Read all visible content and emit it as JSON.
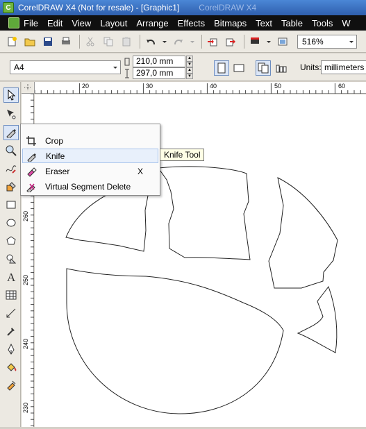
{
  "window": {
    "title": "CorelDRAW X4 (Not for resale) - [Graphic1]",
    "faded_title": "CorelDRAW X4"
  },
  "menu": [
    "File",
    "Edit",
    "View",
    "Layout",
    "Arrange",
    "Effects",
    "Bitmaps",
    "Text",
    "Table",
    "Tools",
    "W"
  ],
  "zoom": "516%",
  "property_bar": {
    "paper": "A4",
    "width": "210,0 mm",
    "height": "297,0 mm",
    "units_label": "Units:",
    "units_value": "millimeters"
  },
  "ruler": {
    "top_labels": [
      "20",
      "30",
      "40",
      "50",
      "60"
    ],
    "left_labels": [
      "260",
      "250",
      "240",
      "230"
    ]
  },
  "flyout": [
    {
      "label": "Crop",
      "shortcut": "",
      "icon": "crop-icon"
    },
    {
      "label": "Knife",
      "shortcut": "",
      "icon": "knife-icon"
    },
    {
      "label": "Eraser",
      "shortcut": "X",
      "icon": "eraser-icon"
    },
    {
      "label": "Virtual Segment Delete",
      "shortcut": "",
      "icon": "virtual-segment-delete-icon"
    }
  ],
  "tooltip": "Knife Tool",
  "toolbox_icons": [
    "pick-tool-icon",
    "shape-tool-icon",
    "knife-tool-icon",
    "zoom-tool-icon",
    "freehand-tool-icon",
    "smart-fill-icon",
    "rectangle-tool-icon",
    "ellipse-tool-icon",
    "polygon-tool-icon",
    "basic-shapes-icon",
    "text-tool-icon",
    "table-tool-icon",
    "dimension-tool-icon",
    "eyedropper-icon",
    "outline-pen-icon",
    "fill-tool-icon",
    "interactive-fill-icon"
  ]
}
